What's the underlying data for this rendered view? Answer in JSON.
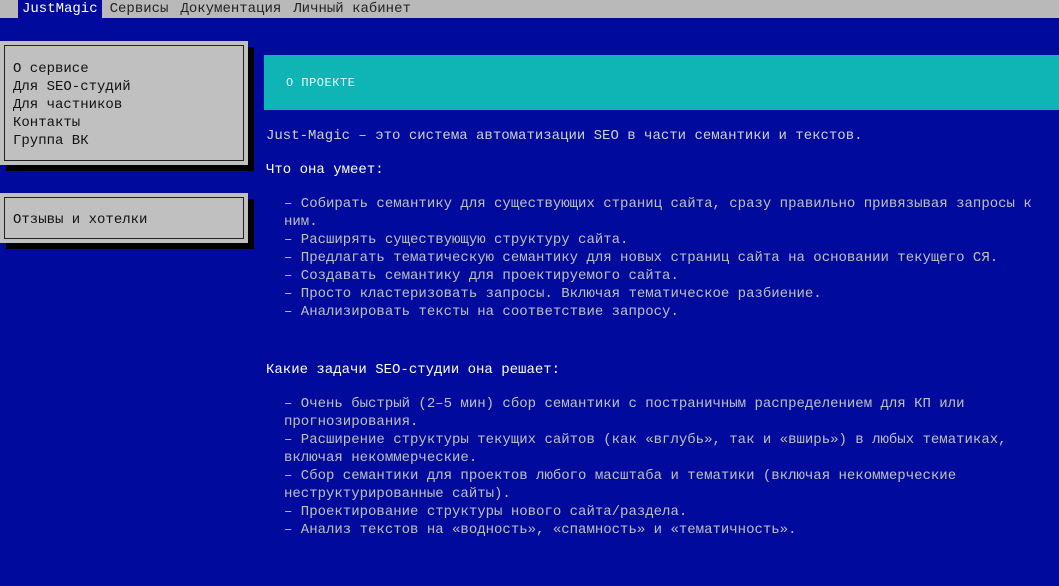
{
  "topbar": {
    "items": [
      {
        "label": "JustMagic"
      },
      {
        "label": "Сервисы"
      },
      {
        "label": "Документация"
      },
      {
        "label": "Личный кабинет"
      }
    ]
  },
  "sidebar": {
    "nav": [
      {
        "label": "О сервисе"
      },
      {
        "label": "Для SEO-студий"
      },
      {
        "label": "Для частников"
      },
      {
        "label": "Контакты"
      },
      {
        "label": "Группа ВК"
      }
    ],
    "feedback": {
      "label": "Отзывы и хотелки"
    }
  },
  "hero": {
    "title": "О ПРОЕКТЕ"
  },
  "content": {
    "intro": "Just-Magic – это система автоматизации SEO в части семантики и текстов.",
    "section1_title": "Что она умеет:",
    "section1_items": "– Собирать семантику для существующих страниц сайта, сразу правильно привязывая запросы к ним.\n– Расширять существующую структуру сайта.\n– Предлагать тематическую семантику для новых страниц сайта на основании текущего СЯ.\n– Создавать семантику для проектируемого сайта.\n– Просто кластеризовать запросы. Включая тематическое разбиение.\n– Анализировать тексты на соответствие запросу.",
    "section2_title": "Какие задачи SEO-студии она решает:",
    "section2_items": "– Очень быстрый (2–5 мин) сбор семантики с постраничным распределением для КП или прогнозирования.\n– Расширение структуры текущих сайтов (как «вглубь», так и «вширь») в любых тематиках, включая некоммерческие.\n– Сбор семантики для проектов любого масштаба и тематики (включая некоммерческие неструктурированные сайты).\n– Проектирование структуры нового сайта/раздела.\n– Анализ текстов на «водность», «спамность» и «тематичность»."
  }
}
